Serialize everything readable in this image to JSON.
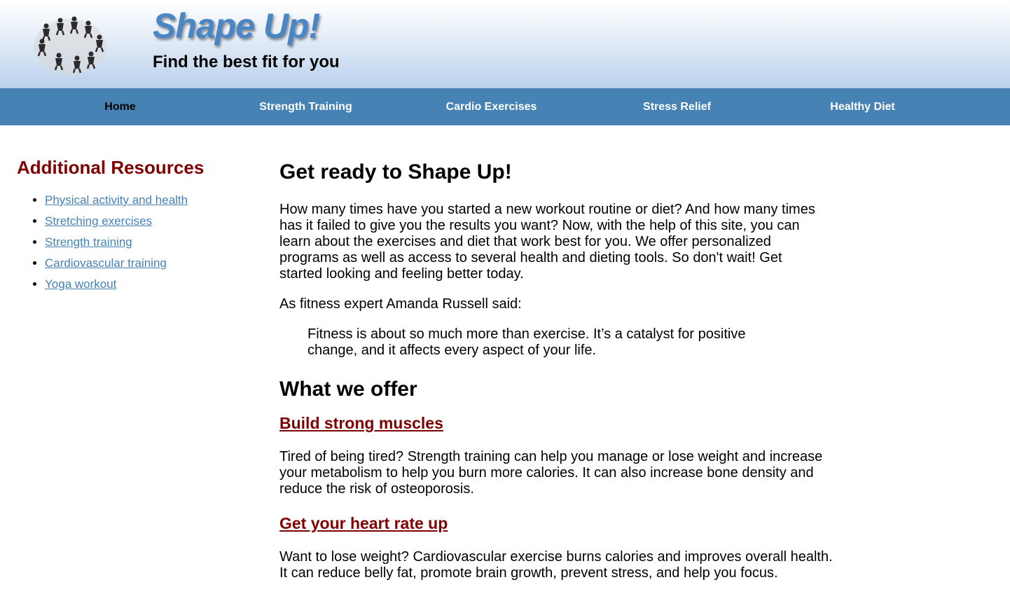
{
  "header": {
    "title": "Shape Up!",
    "tagline": "Find the best fit for you",
    "logo_icon": "people-circle-logo",
    "title_color": "#4a86c5"
  },
  "nav": {
    "background": "#4682b4",
    "items": [
      {
        "label": "Home",
        "active": true
      },
      {
        "label": "Strength Training"
      },
      {
        "label": "Cardio Exercises"
      },
      {
        "label": "Stress Relief"
      },
      {
        "label": "Healthy Diet"
      }
    ]
  },
  "sidebar": {
    "heading": "Additional Resources",
    "links": [
      "Physical activity and health",
      "Stretching exercises",
      "Strength training",
      "Cardiovascular training",
      "Yoga workout"
    ]
  },
  "main": {
    "heading": "Get ready to Shape Up!",
    "intro": "How many times have you started a new workout routine or diet? And how many times has it failed to give you the results you want? Now, with the help of this site, you can learn about the exercises and diet that work best for you. We offer personalized programs as well as access to several health and dieting tools. So don't wait! Get started looking and feeling better today.",
    "expert_line": "As fitness expert Amanda Russell said:",
    "quote": "Fitness is about so much more than exercise. It’s a catalyst for positive change, and it affects every aspect of your life.",
    "offer_heading": "What we offer",
    "offers": [
      {
        "title": "Build strong muscles",
        "text": "Tired of being tired? Strength training can help you manage or lose weight and increase your metabolism to help you burn more calories. It can also increase bone density and reduce the risk of osteoporosis."
      },
      {
        "title": "Get your heart rate up",
        "text": "Want to lose weight? Cardiovascular exercise burns calories and improves overall health. It can reduce belly fat, promote brain growth, prevent stress, and help you focus."
      }
    ]
  },
  "colors": {
    "accent": "#800000",
    "link": "#4682b4"
  }
}
